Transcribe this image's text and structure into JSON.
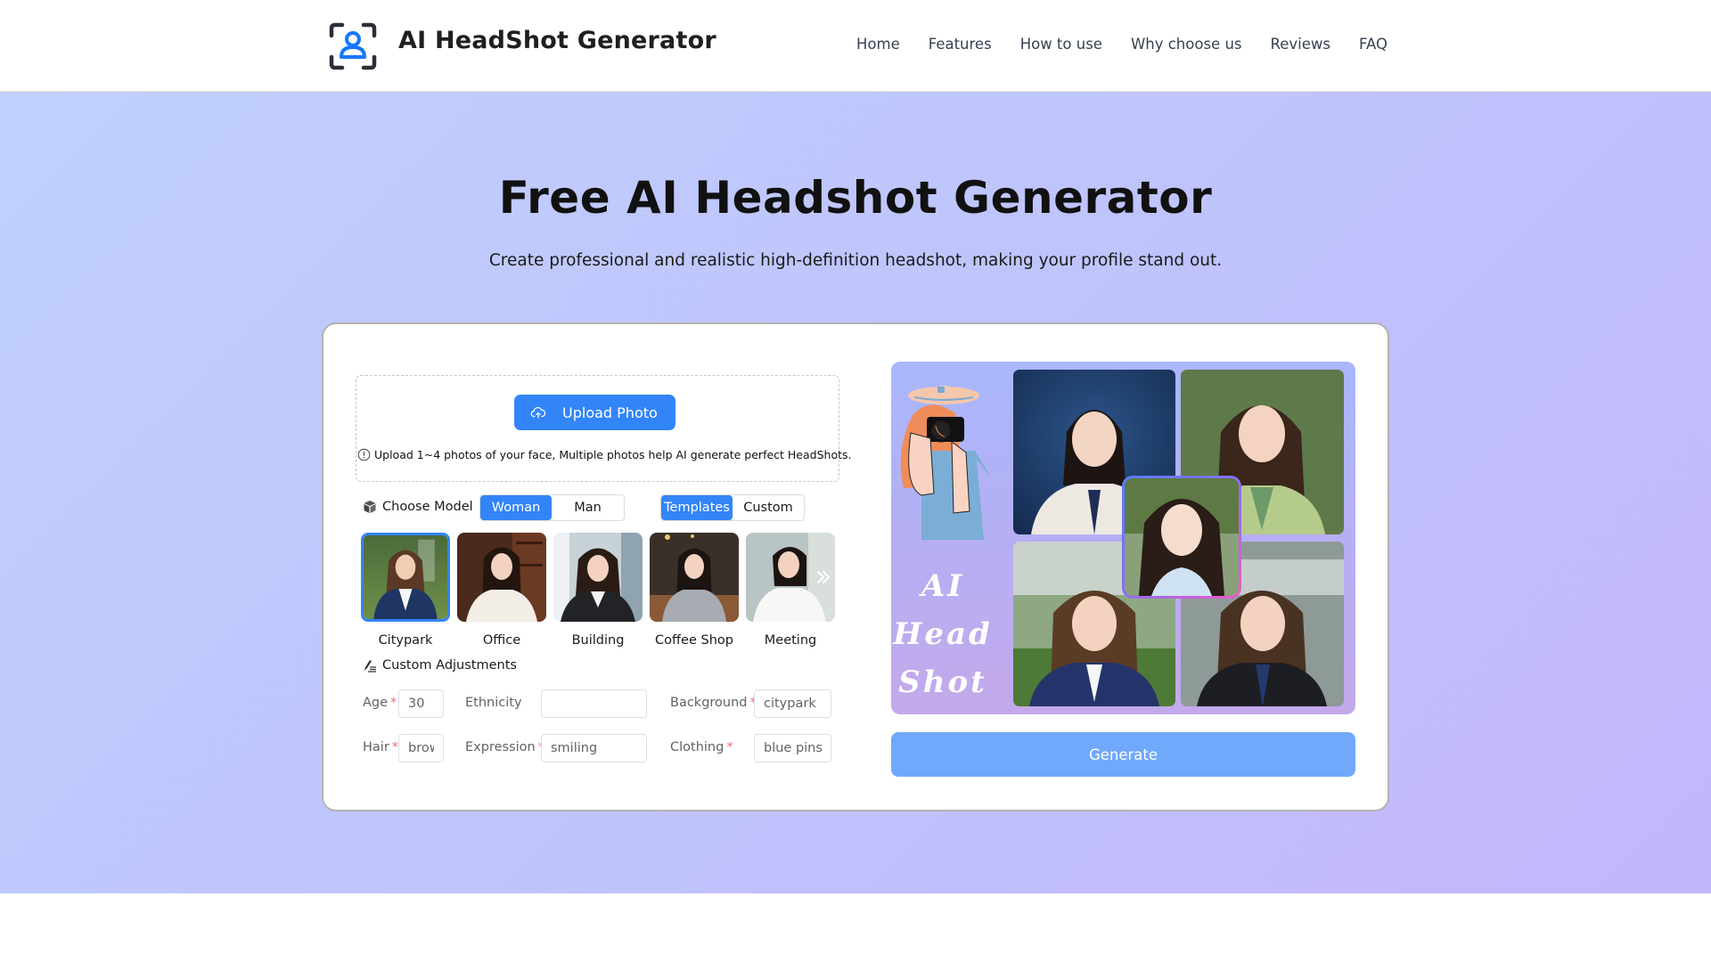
{
  "header": {
    "brand": "AI HeadShot Generator",
    "logo_icon": "user-scan-icon",
    "nav": [
      {
        "label": "Home"
      },
      {
        "label": "Features"
      },
      {
        "label": "How to use"
      },
      {
        "label": "Why choose us"
      },
      {
        "label": "Reviews"
      },
      {
        "label": "FAQ"
      }
    ]
  },
  "hero": {
    "title": "Free AI Headshot Generator",
    "subtitle": "Create professional and realistic high-definition headshot, making your profile stand out."
  },
  "upload": {
    "button_label": "Upload Photo",
    "button_icon": "cloud-upload-icon",
    "hint_icon": "info-circle-icon",
    "hint": "Upload 1~4 photos of your face, Multiple photos help AI generate perfect HeadShots."
  },
  "model": {
    "label": "Choose Model",
    "icon": "cube-icon",
    "gender_options": [
      {
        "label": "Woman",
        "selected": true
      },
      {
        "label": "Man",
        "selected": false
      }
    ],
    "mode_options": [
      {
        "label": "Templates",
        "selected": true
      },
      {
        "label": "Custom",
        "selected": false
      }
    ],
    "templates": [
      {
        "label": "Citypark",
        "selected": true
      },
      {
        "label": "Office",
        "selected": false
      },
      {
        "label": "Building",
        "selected": false
      },
      {
        "label": "Coffee Shop",
        "selected": false
      },
      {
        "label": "Meeting",
        "selected": false
      }
    ],
    "next_icon": "double-chevron-right-icon"
  },
  "adjustments": {
    "label": "Custom Adjustments",
    "icon": "edit-list-icon",
    "required_mark": "*",
    "fields": {
      "age": {
        "label": "Age",
        "value": "30",
        "required": true
      },
      "ethnicity": {
        "label": "Ethnicity",
        "value": "",
        "required": false
      },
      "background": {
        "label": "Background",
        "value": "citypark",
        "required": true
      },
      "hair": {
        "label": "Hair",
        "value": "brown",
        "required": true
      },
      "expression": {
        "label": "Expression",
        "value": "smiling",
        "required": true
      },
      "clothing": {
        "label": "Clothing",
        "value": "blue pinstripe suit",
        "required": true
      }
    }
  },
  "showcase": {
    "caption_lines": [
      "AI",
      "Head",
      "Shot"
    ]
  },
  "generate": {
    "label": "Generate"
  },
  "colors": {
    "accent": "#3385f7",
    "generate_disabled": "#70a8fb",
    "required": "#f56c6c"
  }
}
